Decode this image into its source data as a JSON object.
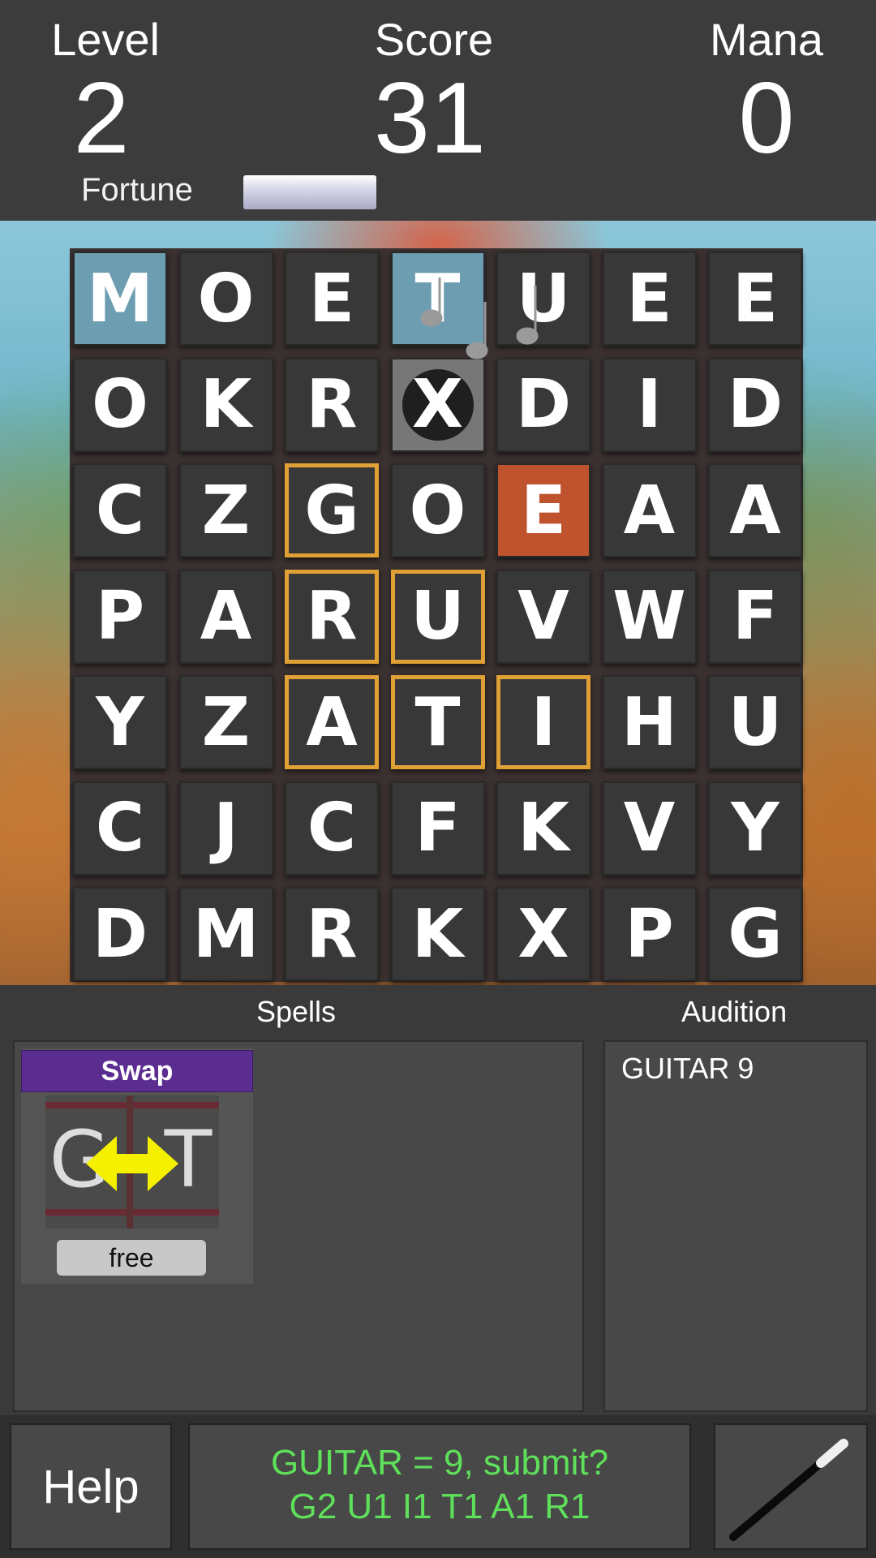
{
  "header": {
    "level_label": "Level",
    "level_value": "2",
    "score_label": "Score",
    "score_value": "31",
    "mana_label": "Mana",
    "mana_value": "0",
    "fortune_label": "Fortune",
    "fortune_fill": 1.0
  },
  "board": {
    "rows": [
      [
        "M",
        "O",
        "E",
        "T",
        "U",
        "E",
        "E"
      ],
      [
        "O",
        "K",
        "R",
        "X",
        "D",
        "I",
        "D"
      ],
      [
        "C",
        "Z",
        "G",
        "O",
        "E",
        "A",
        "A"
      ],
      [
        "P",
        "A",
        "R",
        "U",
        "V",
        "W",
        "F"
      ],
      [
        "Y",
        "Z",
        "A",
        "T",
        "I",
        "H",
        "U"
      ],
      [
        "C",
        "J",
        "C",
        "F",
        "K",
        "V",
        "Y"
      ],
      [
        "D",
        "M",
        "R",
        "K",
        "X",
        "P",
        "G"
      ]
    ],
    "highlighted_blue": [
      [
        0,
        0
      ],
      [
        0,
        3
      ]
    ],
    "highlighted_orange": [
      [
        2,
        4
      ]
    ],
    "blocked_tiles": [
      [
        1,
        3
      ]
    ],
    "selected_path": [
      [
        2,
        2
      ],
      [
        3,
        2
      ],
      [
        3,
        3
      ],
      [
        4,
        2
      ],
      [
        4,
        3
      ],
      [
        4,
        4
      ]
    ]
  },
  "spells": {
    "label": "Spells",
    "items": [
      {
        "name": "Swap",
        "icon": "swap-arrows-icon",
        "cost": "free",
        "left_letter": "G",
        "right_letter": "T"
      }
    ]
  },
  "audition": {
    "label": "Audition",
    "entries": [
      "GUITAR 9"
    ]
  },
  "bottom": {
    "help_label": "Help",
    "message_line1": "GUITAR = 9, submit?",
    "message_line2": "G2 U1 I1 T1 A1 R1",
    "wand_icon": "magic-wand-icon"
  },
  "colors": {
    "message_text": "#5fe05a",
    "selection_border": "#e0a036",
    "tile_blue": "#6d9db1",
    "tile_orange": "#bf532e",
    "spell_header": "#5b2d90"
  }
}
